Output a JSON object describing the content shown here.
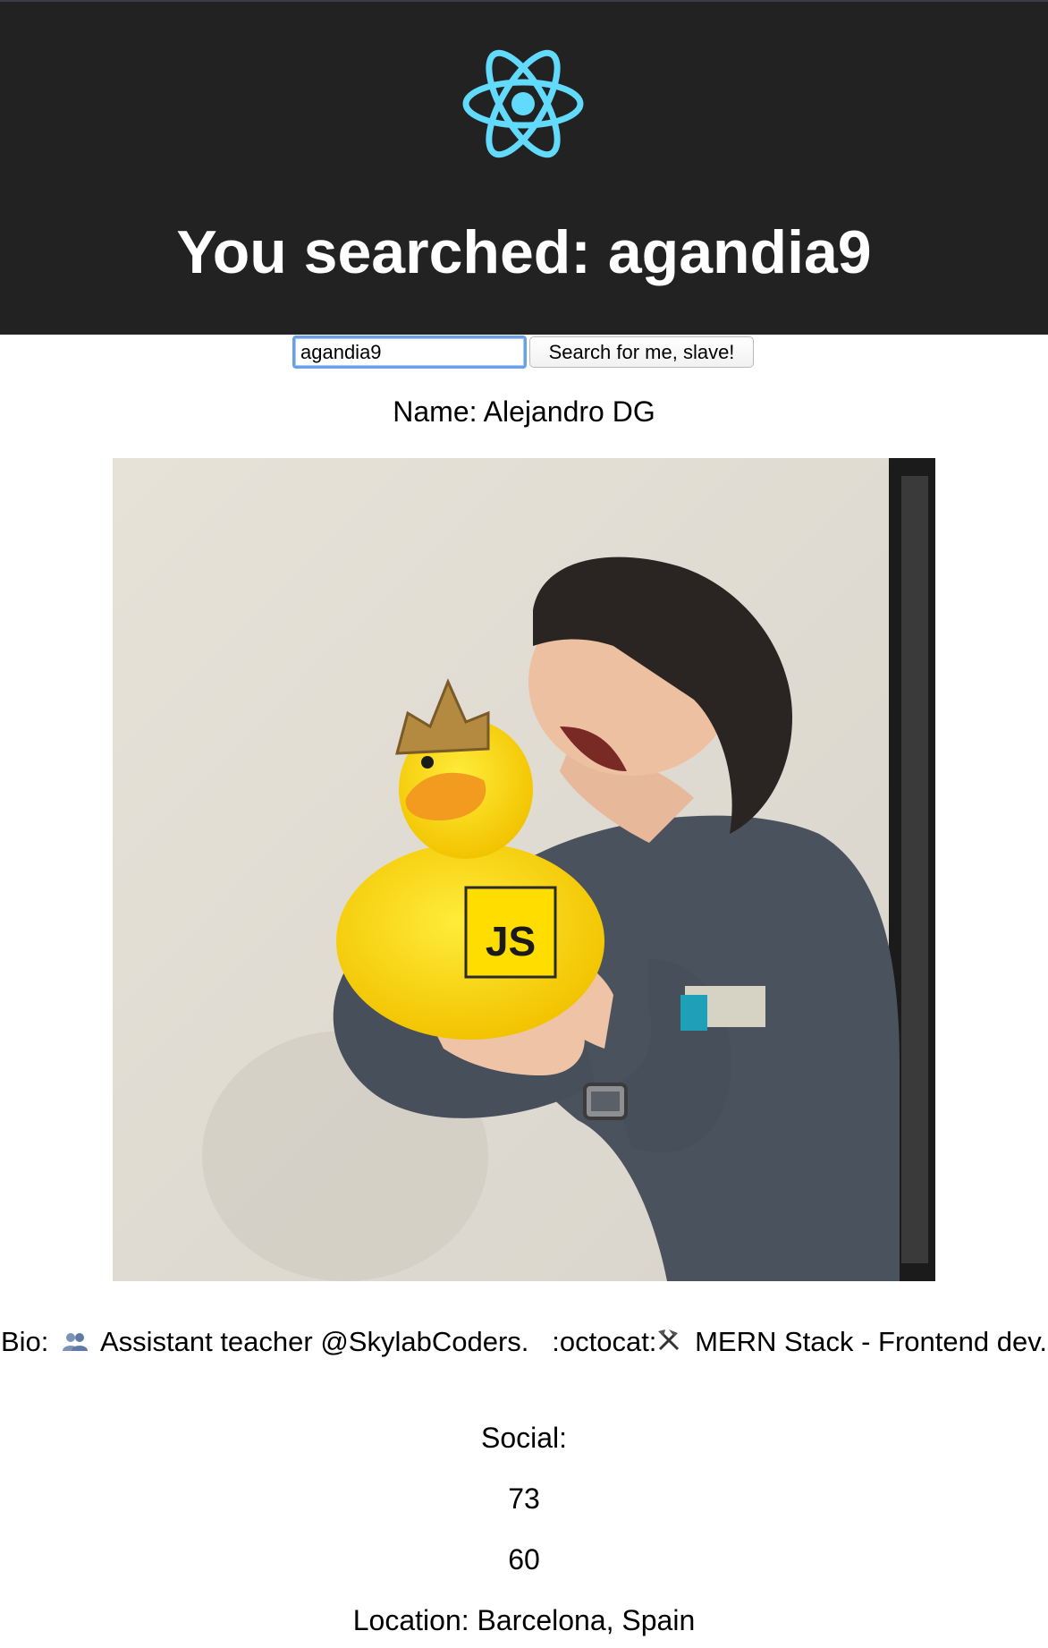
{
  "header": {
    "title": "You searched: agandia9",
    "logo_color": "#61dafb",
    "background": "#222222"
  },
  "search": {
    "value": "agandia9",
    "button_label": "Search for me, slave!"
  },
  "profile": {
    "name_line": "Name: Alejandro DG",
    "bio_prefix": "Bio:",
    "bio_part1": "Assistant teacher @SkylabCoders.",
    "bio_part2": ":octocat:",
    "bio_part3": "MERN Stack - Frontend dev.",
    "social_label": "Social:",
    "followers": "73",
    "following": "60",
    "location_line": "Location: Barcelona, Spain"
  },
  "icons": {
    "logo": "react-logo-icon",
    "bio_emoji_1": "busts-in-silhouette-icon",
    "bio_emoji_2": "hammer-and-pick-icon"
  }
}
